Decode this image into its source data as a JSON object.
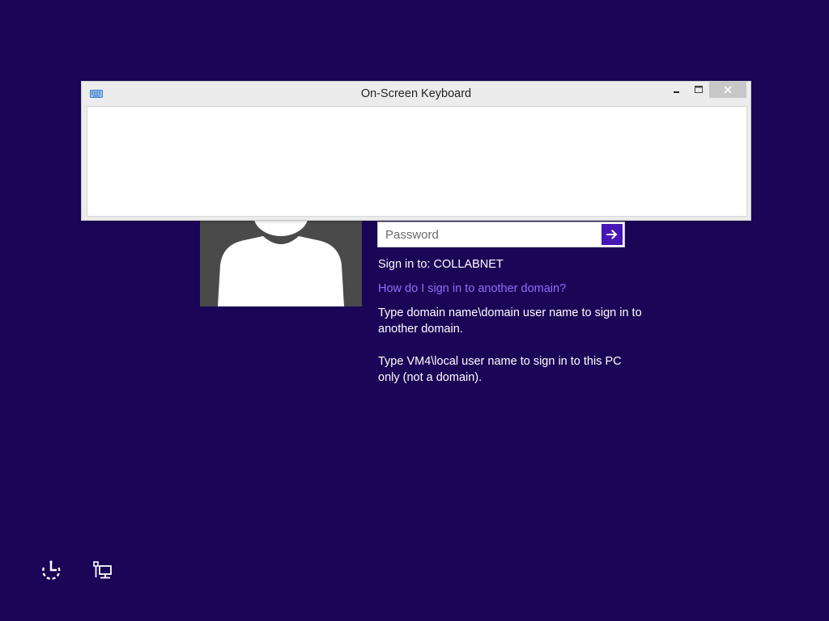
{
  "background_color": "#1b0557",
  "accent_color": "#4617b4",
  "link_color": "#8f70f5",
  "osk": {
    "title": "On-Screen Keyboard",
    "icon": "keyboard-icon",
    "buttons": {
      "minimize": "minimize-icon",
      "maximize": "maximize-icon",
      "close": "close-icon"
    }
  },
  "user": {
    "avatar": "user-avatar"
  },
  "login": {
    "password_placeholder": "Password",
    "submit_icon": "arrow-right-icon",
    "sign_in_to": "Sign in to: COLLABNET",
    "domain_link": "How do I sign in to another domain?",
    "hint_domain": "Type domain name\\domain user name to sign in to another domain.",
    "hint_local": "Type VM4\\local user name to sign in to this PC only (not a domain)."
  },
  "corner_icons": {
    "ease_of_access": "ease-of-access-icon",
    "network": "network-icon"
  }
}
